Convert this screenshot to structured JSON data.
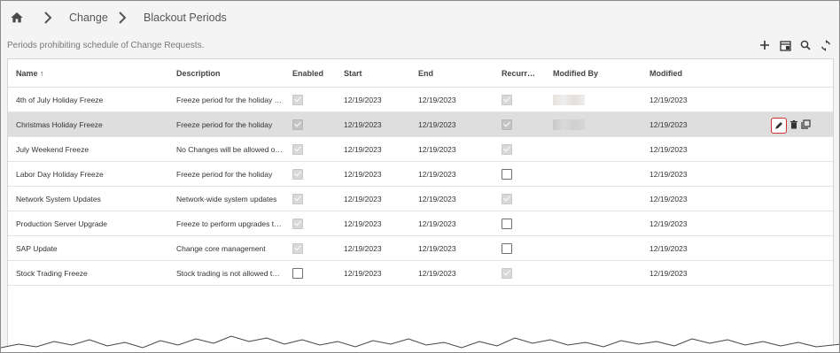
{
  "breadcrumb": {
    "home_icon": "home-icon",
    "items": [
      "Change",
      "Blackout Periods"
    ]
  },
  "subtitle": "Periods prohibiting schedule of Change Requests.",
  "toolbar": {
    "icons": [
      "add-icon",
      "export-icon",
      "search-icon",
      "refresh-icon"
    ]
  },
  "table": {
    "columns": [
      "Name ↑",
      "Description",
      "Enabled",
      "Start",
      "End",
      "Recurr…",
      "Modified By",
      "Modified"
    ],
    "rows": [
      {
        "name": "4th of July Holiday Freeze",
        "description": "Freeze period for the holiday …",
        "enabled": true,
        "start": "12/19/2023",
        "end": "12/19/2023",
        "recurring": true,
        "modified": "12/19/2023"
      },
      {
        "name": "Christmas Holiday Freeze",
        "description": "Freeze period for the holiday",
        "enabled": true,
        "start": "12/19/2023",
        "end": "12/19/2023",
        "recurring": true,
        "modified": "12/19/2023"
      },
      {
        "name": "July Weekend Freeze",
        "description": "No Changes will be allowed o…",
        "enabled": true,
        "start": "12/19/2023",
        "end": "12/19/2023",
        "recurring": true,
        "modified": "12/19/2023"
      },
      {
        "name": "Labor Day Holiday Freeze",
        "description": "Freeze period for the holiday",
        "enabled": true,
        "start": "12/19/2023",
        "end": "12/19/2023",
        "recurring": false,
        "modified": "12/19/2023"
      },
      {
        "name": "Network System Updates",
        "description": "Network-wide system updates",
        "enabled": true,
        "start": "12/19/2023",
        "end": "12/19/2023",
        "recurring": true,
        "modified": "12/19/2023"
      },
      {
        "name": "Production Server Upgrade",
        "description": "Freeze to perform upgrades t…",
        "enabled": true,
        "start": "12/19/2023",
        "end": "12/19/2023",
        "recurring": false,
        "modified": "12/19/2023"
      },
      {
        "name": "SAP Update",
        "description": "Change core management",
        "enabled": true,
        "start": "12/19/2023",
        "end": "12/19/2023",
        "recurring": false,
        "modified": "12/19/2023"
      },
      {
        "name": "Stock Trading Freeze",
        "description": "Stock trading is not allowed t…",
        "enabled": false,
        "start": "12/19/2023",
        "end": "12/19/2023",
        "recurring": true,
        "modified": "12/19/2023"
      }
    ]
  },
  "row_actions": {
    "icons": [
      "edit-icon",
      "delete-icon",
      "copy-icon"
    ]
  },
  "colors": {
    "accent_highlight": "#d32f2f",
    "selected_row": "#dedede"
  }
}
